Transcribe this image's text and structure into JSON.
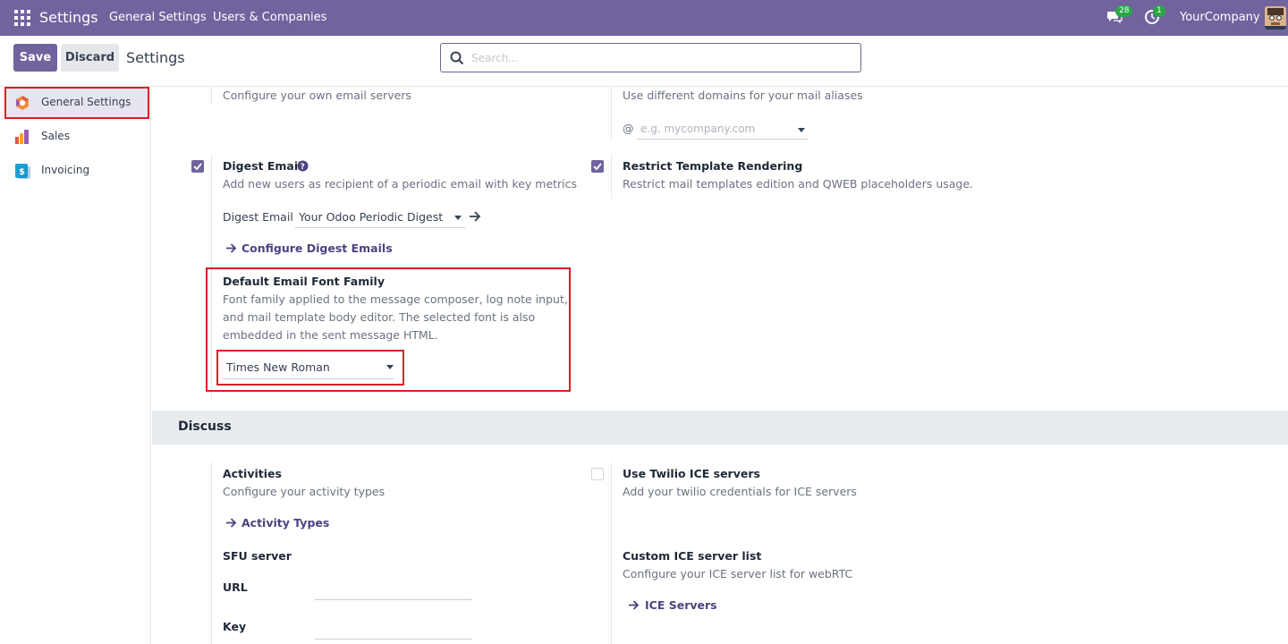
{
  "navbar": {
    "app_title": "Settings",
    "menu_general": "General Settings",
    "menu_users": "Users & Companies",
    "messages_count": "28",
    "activities_count": "1",
    "company": "YourCompany"
  },
  "control": {
    "save_label": "Save",
    "discard_label": "Discard",
    "title": "Settings",
    "search_placeholder": "Search..."
  },
  "sidebar": {
    "items": [
      {
        "label": "General Settings",
        "icon": "settings-app-icon"
      },
      {
        "label": "Sales",
        "icon": "sales-app-icon"
      },
      {
        "label": "Invoicing",
        "icon": "invoicing-app-icon"
      }
    ]
  },
  "email": {
    "mail_servers_desc": "Configure your own email servers",
    "alias_domain_desc": "Use different domains for your mail aliases",
    "alias_at": "@",
    "alias_placeholder": "e.g. mycompany.com",
    "digest_label": "Digest Email",
    "digest_desc": "Add new users as recipient of a periodic email with key metrics",
    "digest_field_label": "Digest Email",
    "digest_value": "Your Odoo Periodic Digest",
    "configure_digest_link": "Configure Digest Emails",
    "restrict_label": "Restrict Template Rendering",
    "restrict_desc": "Restrict mail templates edition and QWEB placeholders usage.",
    "font_label": "Default Email Font Family",
    "font_desc_1": "Font family applied to the message composer, log note input,",
    "font_desc_2": "and mail template body editor. The selected font is also",
    "font_desc_3": "embedded in the sent message HTML.",
    "font_value": "Times New Roman"
  },
  "discuss": {
    "section_title": "Discuss",
    "activities_label": "Activities",
    "activities_desc": "Configure your activity types",
    "activity_types_link": "Activity Types",
    "twilio_label": "Use Twilio ICE servers",
    "twilio_desc": "Add your twilio credentials for ICE servers",
    "sfu_label": "SFU server",
    "url_label": "URL",
    "key_label": "Key",
    "ice_list_label": "Custom ICE server list",
    "ice_list_desc": "Configure your ICE server list for webRTC",
    "ice_servers_link": "ICE Servers"
  },
  "colors": {
    "brand": "#71639e",
    "highlight": "#e01b24",
    "badge": "#28a745"
  }
}
